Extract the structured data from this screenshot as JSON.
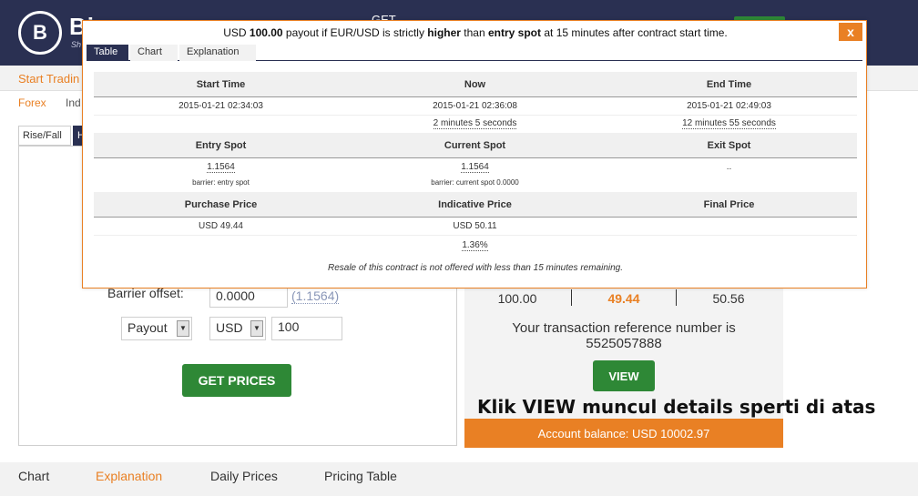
{
  "topbar": {
    "logo_mark": "B",
    "logo_text": "Bi",
    "logo_sub": "Sh",
    "link_label": "GET",
    "accent": "#e98024",
    "navy": "#2a3052",
    "green": "#2e8836"
  },
  "nav": {
    "start_trading": "Start Tradin",
    "forex": "Forex",
    "indices": "Ind",
    "trade_tabs": [
      "Rise/Fall",
      "H"
    ]
  },
  "form": {
    "barrier_label": "Barrier offset:",
    "barrier_value": "0.0000",
    "barrier_link": "(1.1564)",
    "payout_label": "Payout",
    "currency": "USD",
    "amount": "100",
    "get_prices": "GET PRICES"
  },
  "result": {
    "prices": [
      "100.00",
      "49.44",
      "50.56"
    ],
    "tx_text_1": "Your transaction reference number is",
    "tx_number": "5525057888",
    "view_button": "VIEW",
    "annotation": "Klik VIEW muncul details sperti di atas",
    "balance": "Account balance: USD 10002.97"
  },
  "bottom_tabs": [
    "Chart",
    "Explanation",
    "Daily Prices",
    "Pricing Table"
  ],
  "modal": {
    "title_pre": "USD ",
    "title_amount": "100.00",
    "title_mid": " payout if EUR/USD is strictly ",
    "title_higher": "higher",
    "title_than": " than ",
    "title_entry": "entry spot",
    "title_post": " at 15 minutes after contract start time.",
    "close": "x",
    "tabs": [
      "Table",
      "Chart",
      "Explanation"
    ],
    "headers1": [
      "Start Time",
      "Now",
      "End Time"
    ],
    "times": [
      "2015-01-21 02:34:03",
      "2015-01-21 02:36:08",
      "2015-01-21 02:49:03"
    ],
    "durations": [
      "",
      "2 minutes 5 seconds",
      "12 minutes 55 seconds"
    ],
    "headers2": [
      "Entry Spot",
      "Current Spot",
      "Exit Spot"
    ],
    "spots": [
      "1.1564",
      "1.1564",
      ".."
    ],
    "barriers": [
      "barrier: entry spot",
      "barrier: current spot  0.0000",
      ""
    ],
    "headers3": [
      "Purchase Price",
      "Indicative Price",
      "Final Price"
    ],
    "prices": [
      "USD 49.44",
      "USD 50.11",
      ""
    ],
    "change": [
      "",
      "1.36%",
      ""
    ],
    "resale": "Resale of this contract is not offered with less than 15 minutes remaining."
  }
}
